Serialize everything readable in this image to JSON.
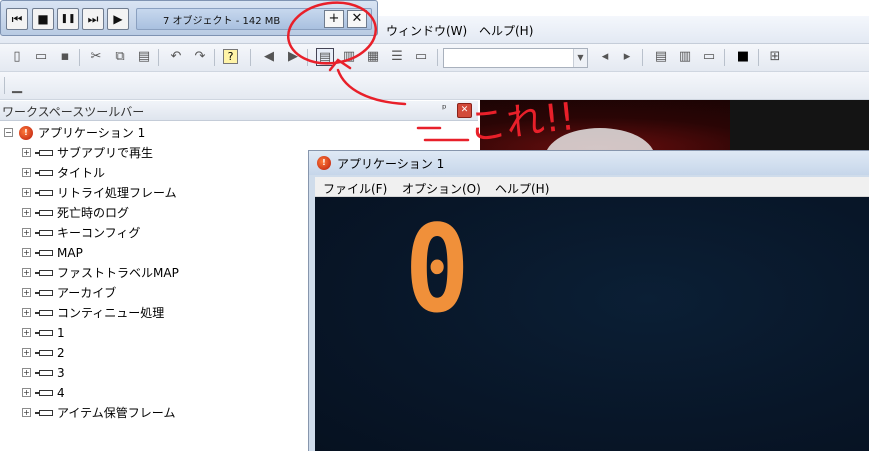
{
  "player": {
    "status_label": "7 オブジェクト - 142 MB",
    "buttons": {
      "first": "⏮",
      "stop": "■",
      "pause": "❚❚",
      "next": "⏭",
      "play": "▶",
      "add": "+",
      "close": "✕"
    }
  },
  "ide": {
    "menus": {
      "window": "ウィンドウ(W)",
      "help": "ヘルプ(H)"
    }
  },
  "workspace": {
    "title": "ワークスペースツールバー",
    "pin": " ⫫",
    "close": "✕",
    "root": {
      "label": "アプリケーション 1"
    },
    "items": [
      {
        "label": "サブアプリで再生"
      },
      {
        "label": "タイトル"
      },
      {
        "label": "リトライ処理フレーム"
      },
      {
        "label": "死亡時のログ"
      },
      {
        "label": "キーコンフィグ"
      },
      {
        "label": "MAP"
      },
      {
        "label": "ファストトラベルMAP"
      },
      {
        "label": "アーカイブ"
      },
      {
        "label": "コンティニュー処理"
      },
      {
        "label": "1"
      },
      {
        "label": "2"
      },
      {
        "label": "3"
      },
      {
        "label": "4"
      },
      {
        "label": "アイテム保管フレーム"
      }
    ]
  },
  "app_window": {
    "title": "アプリケーション 1",
    "menus": {
      "file": "ファイル(F)",
      "options": "オプション(O)",
      "help": "ヘルプ(H)"
    },
    "score": "0"
  },
  "annotation": {
    "text": "これ!!"
  },
  "colors": {
    "annotation": "#e8202a",
    "score": "#f0903a",
    "game_bg": "#081628"
  }
}
